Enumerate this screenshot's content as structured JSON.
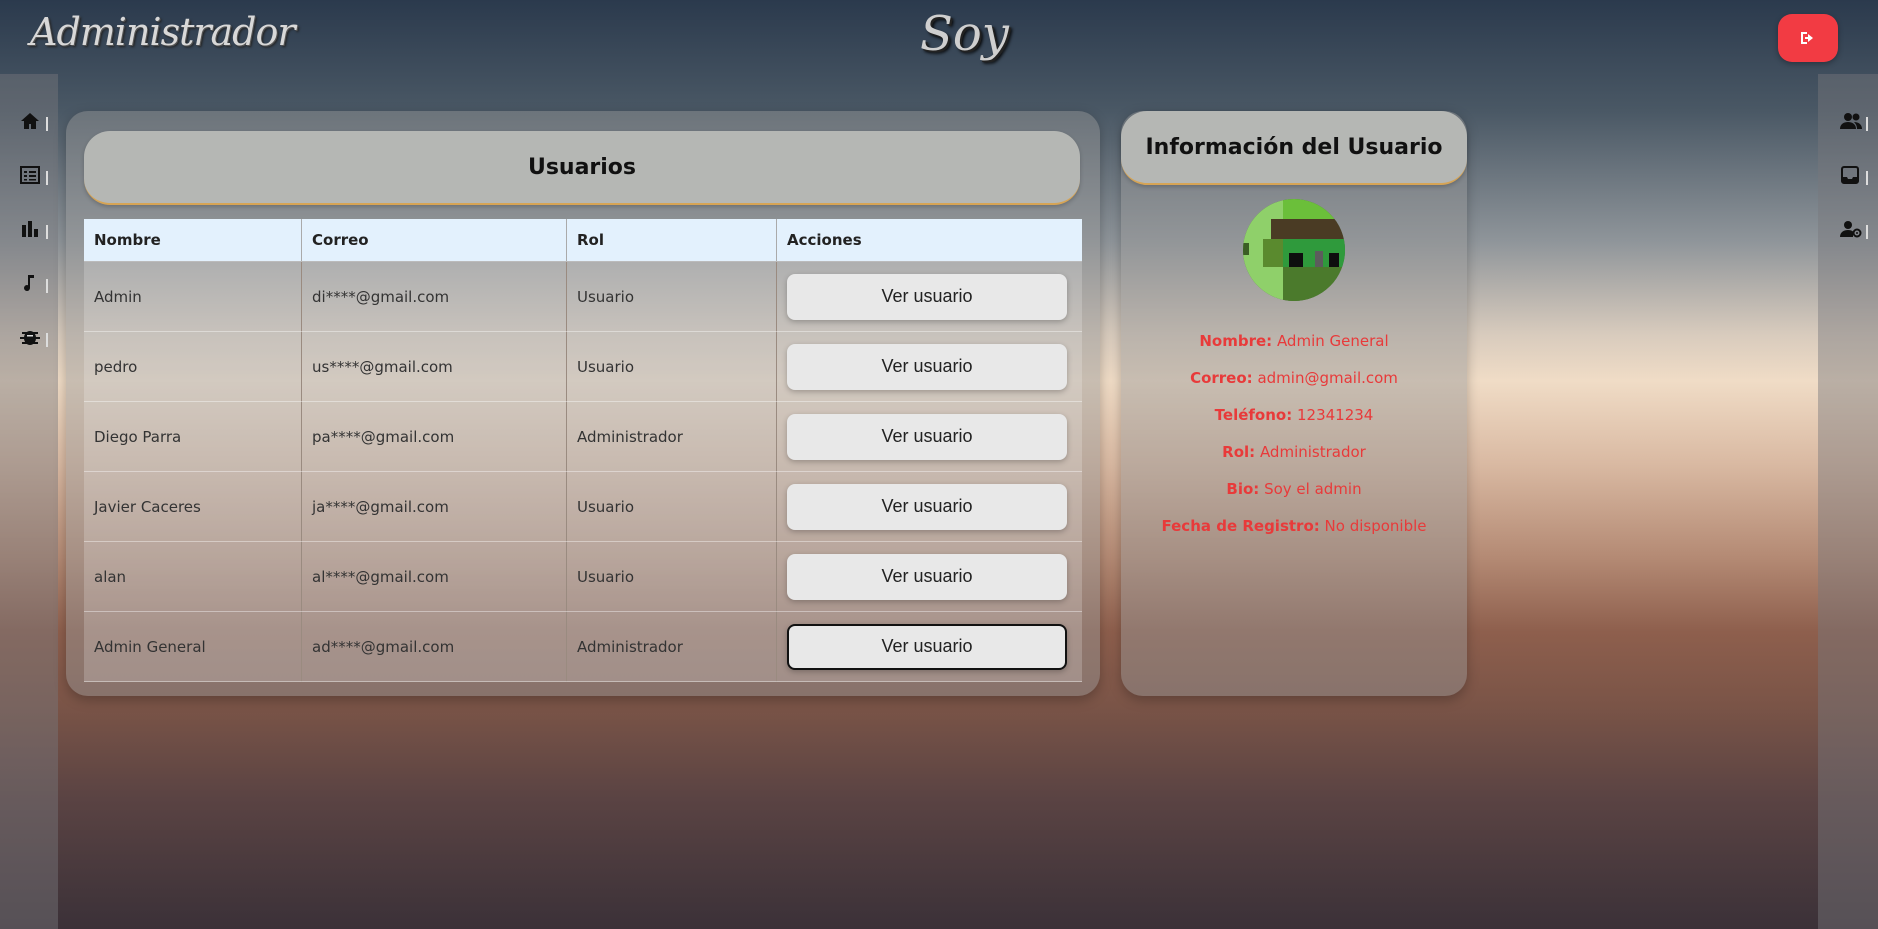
{
  "header": {
    "brand": "Administrador",
    "center_title": "Soy",
    "logout_icon": "sign-out-icon",
    "accent_color": "#f23b43"
  },
  "sidebar_left": {
    "icons": [
      "home-icon",
      "list-icon",
      "bar-chart-icon",
      "music-note-icon",
      "bug-icon"
    ]
  },
  "sidebar_right": {
    "icons": [
      "users-icon",
      "inbox-icon",
      "user-settings-icon"
    ]
  },
  "users": {
    "title": "Usuarios",
    "columns": [
      "Nombre",
      "Correo",
      "Rol",
      "Acciones"
    ],
    "rows": [
      {
        "name": "Admin",
        "email": "di****@gmail.com",
        "role": "Usuario",
        "action": "Ver usuario"
      },
      {
        "name": "pedro",
        "email": "us****@gmail.com",
        "role": "Usuario",
        "action": "Ver usuario"
      },
      {
        "name": "Diego Parra",
        "email": "pa****@gmail.com",
        "role": "Administrador",
        "action": "Ver usuario"
      },
      {
        "name": "Javier Caceres",
        "email": "ja****@gmail.com",
        "role": "Usuario",
        "action": "Ver usuario"
      },
      {
        "name": "alan",
        "email": "al****@gmail.com",
        "role": "Usuario",
        "action": "Ver usuario"
      },
      {
        "name": "Admin General",
        "email": "ad****@gmail.com",
        "role": "Administrador",
        "action": "Ver usuario"
      }
    ]
  },
  "info": {
    "title": "Información del Usuario",
    "fields": [
      {
        "label": "Nombre:",
        "value": "Admin General"
      },
      {
        "label": "Correo:",
        "value": "admin@gmail.com"
      },
      {
        "label": "Teléfono:",
        "value": "12341234"
      },
      {
        "label": "Rol:",
        "value": "Administrador"
      },
      {
        "label": "Bio:",
        "value": "Soy el admin"
      },
      {
        "label": "Fecha de Registro:",
        "value": "No disponible"
      }
    ],
    "text_color": "#e83a3a"
  }
}
